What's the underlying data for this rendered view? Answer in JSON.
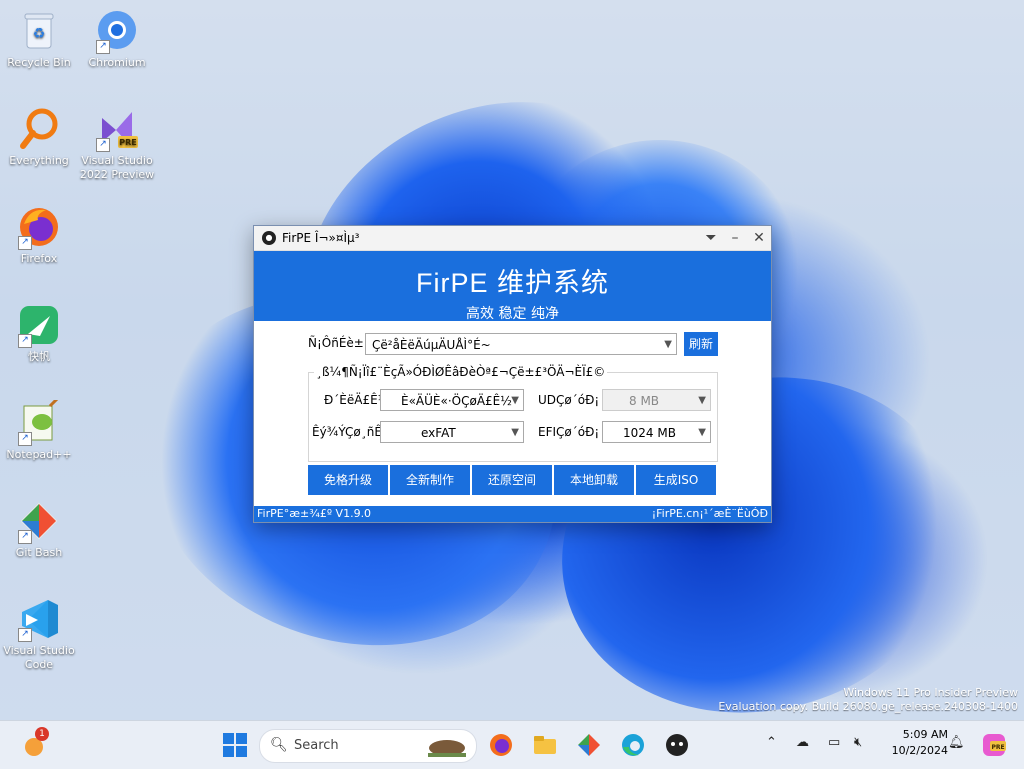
{
  "desktop": {
    "icons": [
      {
        "label": "Recycle Bin"
      },
      {
        "label": "Chromium"
      },
      {
        "label": "Everything"
      },
      {
        "label": "Visual Studio 2022 Preview"
      },
      {
        "label": "Firefox"
      },
      {
        "label": "快帆"
      },
      {
        "label": "Notepad++"
      },
      {
        "label": "Git Bash"
      },
      {
        "label": "Visual Studio Code"
      }
    ],
    "watermark_line1": "Windows 11 Pro Insider Preview",
    "watermark_line2": "Evaluation copy. Build 26080.ge_release.240308-1400"
  },
  "window": {
    "title": "FirPE Î¬»¤Ìµ³",
    "banner_title": "FirPE 维护系统",
    "banner_subtitle": "高效 稳定 纯净",
    "device_label": "Ñ¡ÔñÉè±¸",
    "device_value": "Çë²åÈëÄúµÄUÅÌ°É~",
    "refresh_label": "刷新",
    "group_title": "¸ß¼¶Ñ¡Ïî£¨ÈçÃ»ÓÐÌØÊâÐèÒª£¬Çë±£³ÖÄ¬ÈÏ£©",
    "write_mode_label": "Ð´ÈëÄ£Ê½",
    "write_mode_value": "È«ÄÜÈ«·ÖÇøÄ£Ê½",
    "fs_label": "Êý¾ÝÇø¸ñÊ½",
    "fs_value": "exFAT",
    "udc_label": "UDÇø´óÐ¡",
    "udc_value": "8 MB",
    "efi_label": "EFIÇø´óÐ¡",
    "efi_value": "1024 MB",
    "buttons": [
      "免格升级",
      "全新制作",
      "还原空间",
      "本地卸载",
      "生成ISO"
    ],
    "status_left": "FirPE°æ±¾£º V1.9.0",
    "status_right": "¡FirPE.cn¡¹´æÈ¨ËùÓÐ"
  },
  "taskbar": {
    "search_placeholder": "Search",
    "notification_badge": "1",
    "time": "5:09 AM",
    "date": "10/2/2024"
  },
  "colors": {
    "accent": "#1a6fdd"
  }
}
